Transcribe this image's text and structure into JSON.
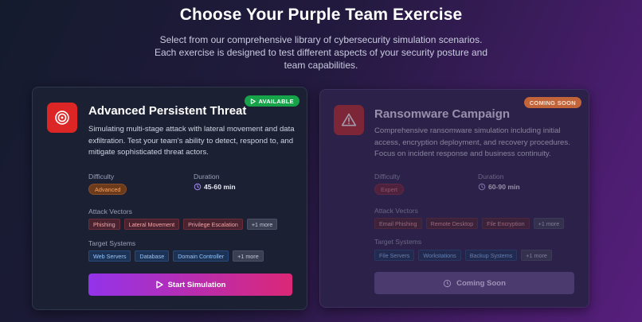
{
  "header": {
    "title": "Choose Your Purple Team Exercise",
    "subtitle": "Select from our comprehensive library of cybersecurity simulation scenarios. Each exercise is designed to test different aspects of your security posture and team capabilities."
  },
  "cards": [
    {
      "icon": "target-icon",
      "badge": "AVAILABLE",
      "title": "Advanced Persistent Threat",
      "description": "Simulating multi-stage attack with lateral movement and data exfiltration. Test your team's ability to detect, respond to, and mitigate sophisticated threat actors.",
      "difficulty_label": "Difficulty",
      "difficulty": "Advanced",
      "duration_label": "Duration",
      "duration": "45-60 min",
      "vectors_label": "Attack Vectors",
      "vectors": [
        "Phishing",
        "Lateral Movement",
        "Privilege Escalation"
      ],
      "vectors_more": "+1 more",
      "systems_label": "Target Systems",
      "systems": [
        "Web Servers",
        "Database",
        "Domain Controller"
      ],
      "systems_more": "+1 more",
      "button": "Start Simulation",
      "button_icon": "play-icon"
    },
    {
      "icon": "warning-triangle-icon",
      "badge": "COMING SOON",
      "title": "Ransomware Campaign",
      "description": "Comprehensive ransomware simulation including initial access, encryption deployment, and recovery procedures. Focus on incident response and business continuity.",
      "difficulty_label": "Difficulty",
      "difficulty": "Expert",
      "duration_label": "Duration",
      "duration": "60-90 min",
      "vectors_label": "Attack Vectors",
      "vectors": [
        "Email Phishing",
        "Remote Desktop",
        "File Encryption"
      ],
      "vectors_more": "+1 more",
      "systems_label": "Target Systems",
      "systems": [
        "File Servers",
        "Workstations",
        "Backup Systems"
      ],
      "systems_more": "+1 more",
      "button": "Coming Soon",
      "button_icon": "clock-icon"
    }
  ],
  "colors": {
    "accent_start": "#9333ea",
    "accent_end": "#db2777",
    "available": "#16a34a",
    "coming_soon": "#c2643a"
  }
}
